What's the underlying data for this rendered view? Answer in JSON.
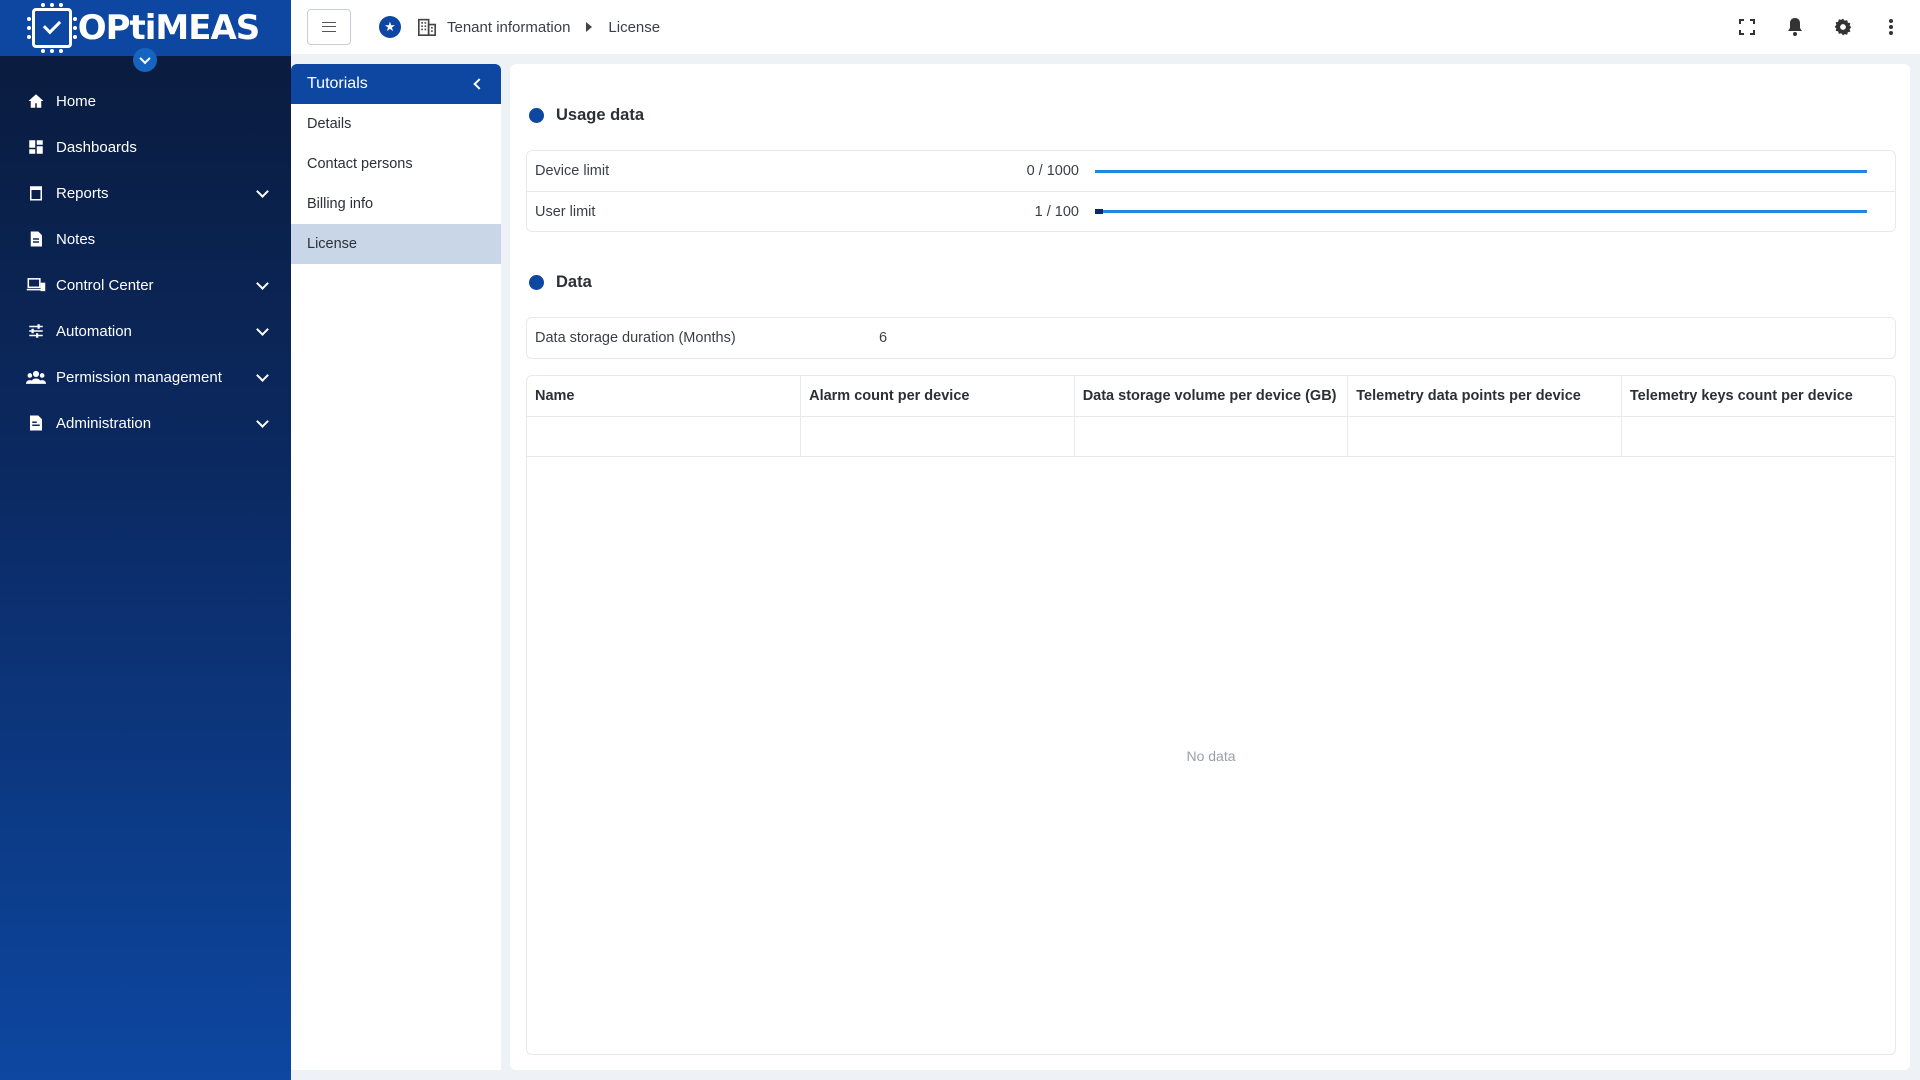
{
  "brand": {
    "name": "OPtiMEAS"
  },
  "sidebar": {
    "items": [
      {
        "label": "Home",
        "icon": "home-icon",
        "expandable": false
      },
      {
        "label": "Dashboards",
        "icon": "dashboard-icon",
        "expandable": false
      },
      {
        "label": "Reports",
        "icon": "clipboard-icon",
        "expandable": true
      },
      {
        "label": "Notes",
        "icon": "document-icon",
        "expandable": false
      },
      {
        "label": "Control Center",
        "icon": "devices-icon",
        "expandable": true
      },
      {
        "label": "Automation",
        "icon": "sliders-icon",
        "expandable": true
      },
      {
        "label": "Permission management",
        "icon": "people-icon",
        "expandable": true
      },
      {
        "label": "Administration",
        "icon": "admin-file-icon",
        "expandable": true
      }
    ]
  },
  "breadcrumb": {
    "parent": "Tenant information",
    "current": "License"
  },
  "subnav": {
    "title": "Tutorials",
    "items": [
      {
        "label": "Details",
        "active": false
      },
      {
        "label": "Contact persons",
        "active": false
      },
      {
        "label": "Billing info",
        "active": false
      },
      {
        "label": "License",
        "active": true
      }
    ]
  },
  "usage": {
    "title": "Usage data",
    "limits": [
      {
        "label": "Device limit",
        "value": "0 / 1000",
        "fraction": 0.0
      },
      {
        "label": "User limit",
        "value": "1 / 100",
        "fraction": 0.01
      }
    ]
  },
  "data_section": {
    "title": "Data",
    "storage_label": "Data storage duration (Months)",
    "storage_value": "6",
    "columns": [
      "Name",
      "Alarm count per device",
      "Data storage volume per device (GB)",
      "Telemetry data points per device",
      "Telemetry keys count per device"
    ],
    "empty_text": "No data"
  },
  "colors": {
    "primary": "#0d47a1",
    "progress": "#1e88e5"
  }
}
